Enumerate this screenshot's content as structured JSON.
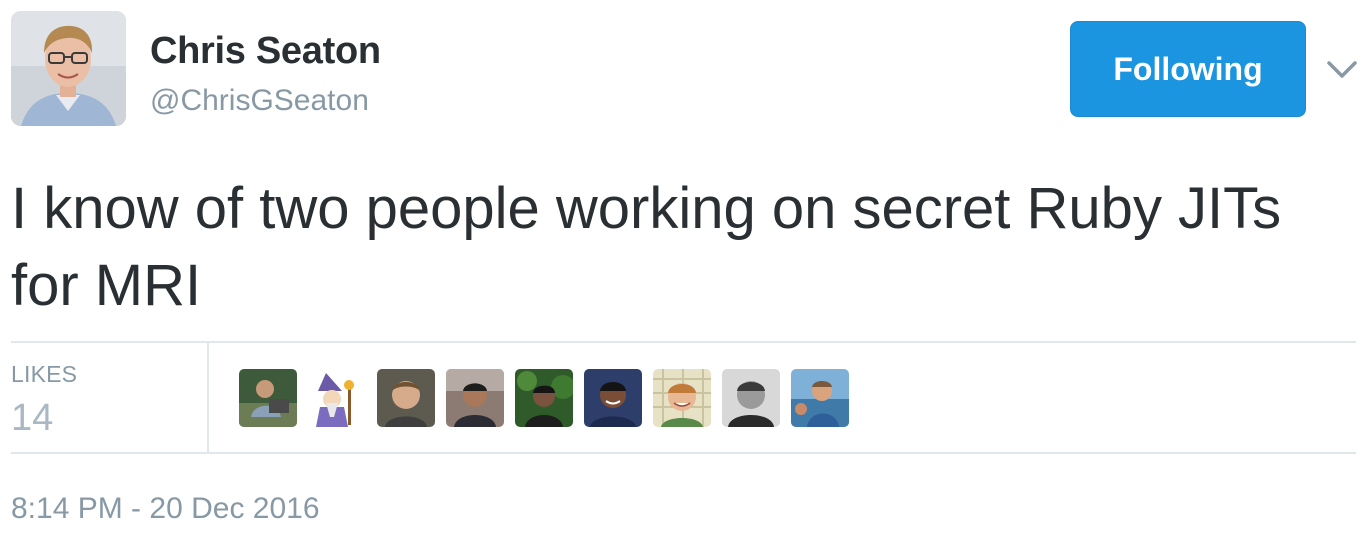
{
  "author": {
    "name": "Chris Seaton",
    "handle": "@ChrisGSeaton",
    "avatar_icon": "profile-photo"
  },
  "follow_button": {
    "label": "Following",
    "color": "#1b95e0"
  },
  "menu_icon": "chevron-down-icon",
  "tweet": {
    "text": "I know of two people working on secret Ruby JITs for MRI"
  },
  "stats": {
    "likes_label": "LIKES",
    "likes_count": "14"
  },
  "likers": [
    {
      "icon": "liker-avatar-1"
    },
    {
      "icon": "liker-avatar-2"
    },
    {
      "icon": "liker-avatar-3"
    },
    {
      "icon": "liker-avatar-4"
    },
    {
      "icon": "liker-avatar-5"
    },
    {
      "icon": "liker-avatar-6"
    },
    {
      "icon": "liker-avatar-7"
    },
    {
      "icon": "liker-avatar-8"
    },
    {
      "icon": "liker-avatar-9"
    }
  ],
  "timestamp": "8:14 PM - 20 Dec 2016"
}
